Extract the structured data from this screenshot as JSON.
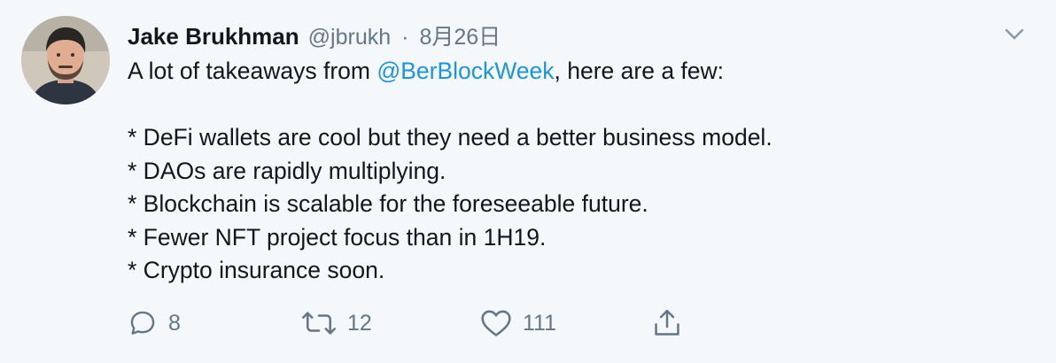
{
  "tweet": {
    "author": {
      "name": "Jake Brukhman",
      "handle": "@jbrukh",
      "separator": "·",
      "date": "8月26日",
      "avatar_icon": "avatar-photo"
    },
    "menu_icon": "chevron-down-icon",
    "text": {
      "line1_pre": "A lot of takeaways from ",
      "line1_mention": "@BerBlockWeek",
      "line1_post": ", here are a few:",
      "bullets": [
        "* DeFi wallets are cool but they need a better business model.",
        "* DAOs are rapidly multiplying.",
        "* Blockchain is scalable for the foreseeable future.",
        "* Fewer NFT project focus than in 1H19.",
        "* Crypto insurance soon."
      ]
    },
    "actions": {
      "reply": {
        "icon": "reply-icon",
        "count": "8"
      },
      "retweet": {
        "icon": "retweet-icon",
        "count": "12"
      },
      "like": {
        "icon": "heart-icon",
        "count": "111"
      },
      "share": {
        "icon": "share-icon"
      }
    },
    "colors": {
      "background": "#f5f8fa",
      "text": "#14171a",
      "secondary": "#657786",
      "link": "#1b95e0"
    }
  }
}
